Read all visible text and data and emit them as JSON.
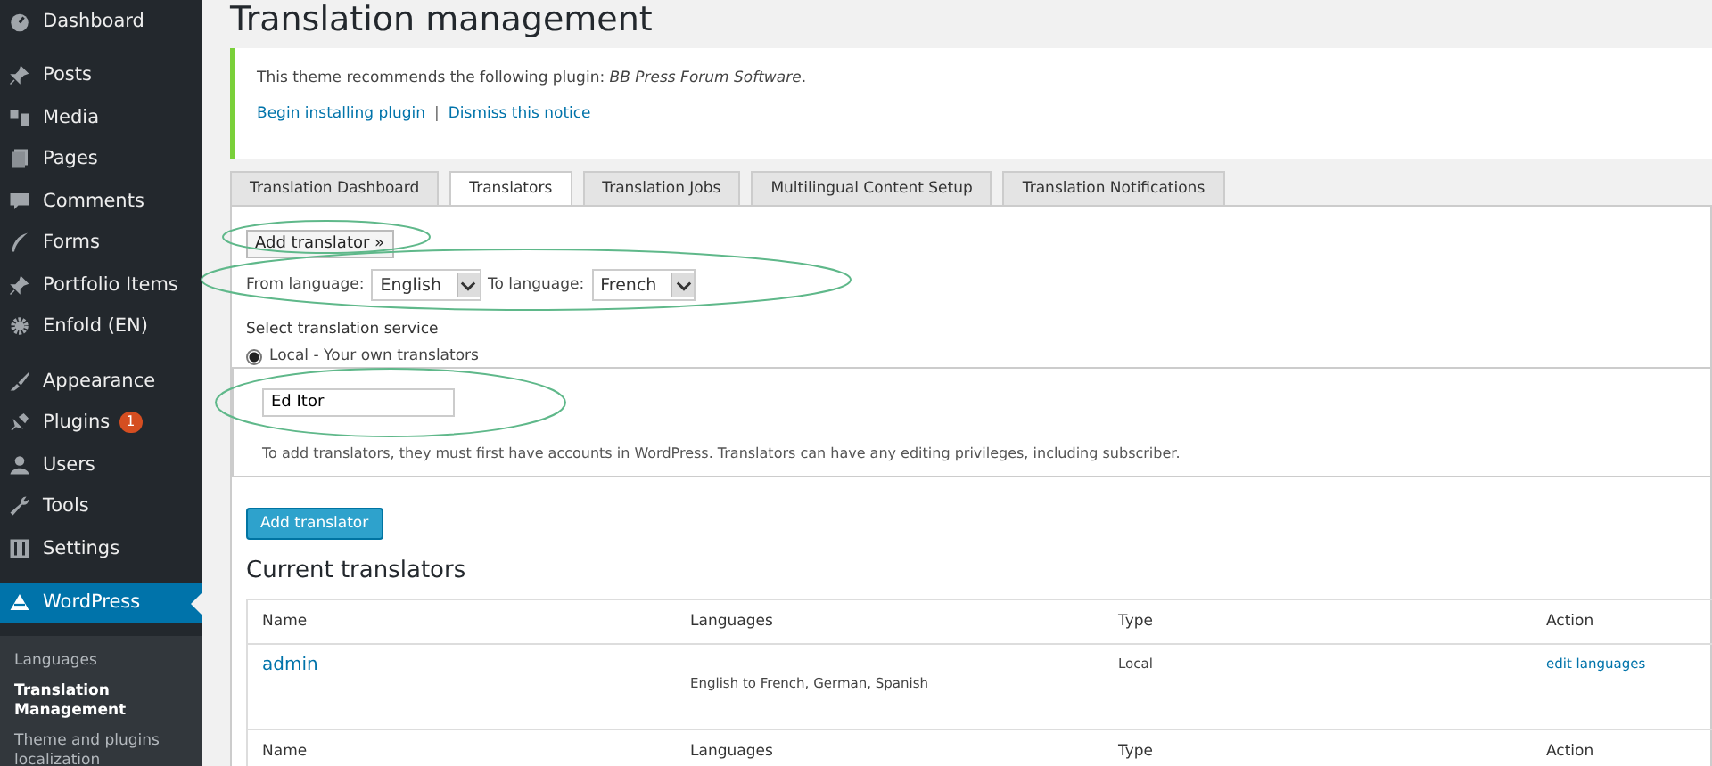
{
  "sidebar": {
    "groups": [
      [
        {
          "label": "Dashboard",
          "selected": false
        }
      ],
      [
        {
          "label": "Posts",
          "selected": false
        },
        {
          "label": "Media",
          "selected": false
        },
        {
          "label": "Pages",
          "selected": false
        },
        {
          "label": "Comments",
          "selected": false
        },
        {
          "label": "Forms",
          "selected": false
        },
        {
          "label": "Portfolio Items",
          "selected": false
        },
        {
          "label": "Enfold (EN)",
          "selected": false
        }
      ],
      [
        {
          "label": "Appearance",
          "selected": false
        },
        {
          "label": "Plugins",
          "selected": false,
          "badge": "1"
        },
        {
          "label": "Users",
          "selected": false
        },
        {
          "label": "Tools",
          "selected": false
        },
        {
          "label": "Settings",
          "selected": false
        }
      ],
      [
        {
          "label": "WordPress",
          "selected": true
        }
      ]
    ],
    "submenu": [
      {
        "label": "Languages",
        "selected": false
      },
      {
        "label": "Translation Management",
        "selected": true
      },
      {
        "label": "Theme and plugins localization",
        "selected": false
      }
    ]
  },
  "page_title": "Translation management",
  "notice": {
    "text": "This theme recommends the following plugin: *BB Press Forum Software*.",
    "links": [
      "Begin installing plugin",
      "Dismiss this notice"
    ],
    "separator": "|"
  },
  "tabs": [
    {
      "label": "Translation Dashboard",
      "selected": false
    },
    {
      "label": "Translators",
      "selected": true
    },
    {
      "label": "Translation Jobs",
      "selected": false
    },
    {
      "label": "Multilingual Content Setup",
      "selected": false
    },
    {
      "label": "Translation Notifications",
      "selected": false
    }
  ],
  "add_toggle": "Add translator »",
  "languages": {
    "from_label": "From language:",
    "from": "English",
    "to_label": "To language:",
    "to": "French"
  },
  "service": {
    "heading": "Select translation service",
    "option": "Local - Your own translators",
    "checked": true,
    "input_value": "Ed Itor",
    "help": "To add translators, they must first have accounts in WordPress. Translators can have any editing privileges, including subscriber."
  },
  "add_button": "Add translator",
  "current_heading": "Current translators",
  "table": {
    "columns": [
      "Name",
      "Languages",
      "Type",
      "Action"
    ],
    "rows": [
      {
        "name": "admin",
        "languages": "English to French, German, Spanish",
        "type": "Local",
        "action": "edit languages"
      }
    ],
    "footer": [
      "Name",
      "Languages",
      "Type",
      "Action"
    ]
  }
}
